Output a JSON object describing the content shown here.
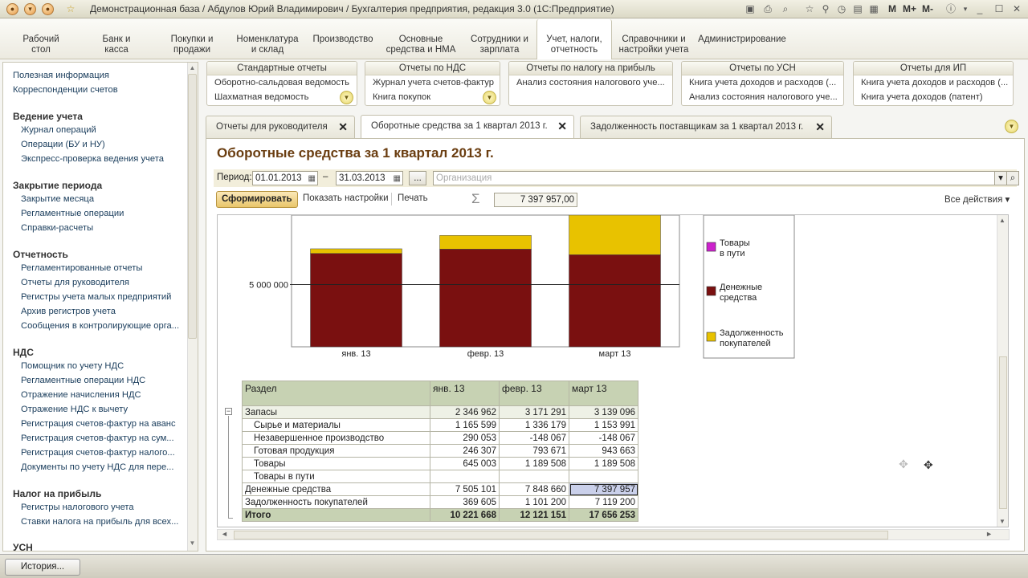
{
  "window": {
    "title": "Демонстрационная база / Абдулов Юрий Владимирович / Бухгалтерия предприятия, редакция 3.0  (1С:Предприятие)",
    "memory_buttons": [
      "M",
      "M+",
      "M-"
    ]
  },
  "sections": [
    "Рабочий стол",
    "Банк и касса",
    "Покупки и продажи",
    "Номенклатура и склад",
    "Производство",
    "Основные средства и НМА",
    "Сотрудники и зарплата",
    "Учет, налоги, отчетность",
    "Справочники и настройки учета",
    "Администрирование"
  ],
  "sidebar": {
    "top_links": [
      "Полезная информация",
      "Корреспонденции счетов"
    ],
    "groups": [
      {
        "title": "Ведение учета",
        "items": [
          "Журнал операций",
          "Операции (БУ и НУ)",
          "Экспресс-проверка ведения учета"
        ]
      },
      {
        "title": "Закрытие периода",
        "items": [
          "Закрытие месяца",
          "Регламентные операции",
          "Справки-расчеты"
        ]
      },
      {
        "title": "Отчетность",
        "items": [
          "Регламентированные отчеты",
          "Отчеты для руководителя",
          "Регистры учета малых предприятий",
          "Архив регистров учета",
          "Сообщения в контролирующие орга..."
        ]
      },
      {
        "title": "НДС",
        "items": [
          "Помощник по учету НДС",
          "Регламентные операции НДС",
          "Отражение начисления НДС",
          "Отражение НДС к вычету",
          "Регистрация счетов-фактур на аванс",
          "Регистрация счетов-фактур на сум...",
          "Регистрация счетов-фактур налого...",
          "Документы по учету НДС для пере..."
        ]
      },
      {
        "title": "Налог на прибыль",
        "items": [
          "Регистры налогового учета",
          "Ставки налога на прибыль для всех..."
        ]
      },
      {
        "title": "УСН",
        "items": []
      }
    ]
  },
  "report_panels": [
    {
      "title": "Стандартные отчеты",
      "items": [
        "Оборотно-сальдовая ведомость",
        "Шахматная ведомость"
      ]
    },
    {
      "title": "Отчеты по НДС",
      "items": [
        "Журнал учета счетов-фактур",
        "Книга покупок"
      ]
    },
    {
      "title": "Отчеты по налогу на прибыль",
      "items": [
        "Анализ состояния налогового уче..."
      ]
    },
    {
      "title": "Отчеты по УСН",
      "items": [
        "Книга учета доходов и расходов (...",
        "Анализ состояния налогового уче..."
      ]
    },
    {
      "title": "Отчеты для ИП",
      "items": [
        "Книга учета доходов и расходов (...",
        "Книга учета доходов (патент)"
      ]
    }
  ],
  "tabs": [
    {
      "label": "Отчеты для руководителя"
    },
    {
      "label": "Оборотные средства за 1 квартал 2013 г."
    },
    {
      "label": "Задолженность поставщикам за 1 квартал 2013 г."
    }
  ],
  "report": {
    "title": "Оборотные средства за 1 квартал 2013 г.",
    "period_label": "Период:",
    "date_from": "01.01.2013",
    "date_sep": "–",
    "date_to": "31.03.2013",
    "ellipsis": "...",
    "org_placeholder": "Организация",
    "form_button": "Сформировать",
    "show_settings": "Показать настройки",
    "print": "Печать",
    "sum_symbol": "Σ",
    "sum_value": "7 397 957,00",
    "all_actions": "Все действия ▾"
  },
  "chart_data": {
    "type": "bar",
    "stacked": true,
    "categories": [
      "янв. 13",
      "февр. 13",
      "март 13"
    ],
    "y_tick_label": "5 000 000",
    "y_tick_value": 5000000,
    "series": [
      {
        "name": "Товары в пути",
        "color": "#cc22cc",
        "values": [
          0,
          0,
          0
        ]
      },
      {
        "name": "Денежные средства",
        "color": "#7a1010",
        "values": [
          7505101,
          7848660,
          7397957
        ]
      },
      {
        "name": "Задолженность покупателей",
        "color": "#e8c200",
        "values": [
          369605,
          1101200,
          7119200
        ]
      }
    ],
    "legend": [
      "Товары в пути",
      "Денежные средства",
      "Задолженность покупателей"
    ],
    "legend_position": "right"
  },
  "table": {
    "headers": [
      "Раздел",
      "янв. 13",
      "февр. 13",
      "март 13"
    ],
    "rows": [
      {
        "label": "Запасы",
        "values": [
          "2 346 962",
          "3 171 291",
          "3 139 096"
        ],
        "kind": "grp"
      },
      {
        "label": "Сырье и материалы",
        "values": [
          "1 165 599",
          "1 336 179",
          "1 153 991"
        ],
        "kind": "sub"
      },
      {
        "label": "Незавершенное производство",
        "values": [
          "290 053",
          "-148 067",
          "-148 067"
        ],
        "kind": "sub"
      },
      {
        "label": "Готовая продукция",
        "values": [
          "246 307",
          "793 671",
          "943 663"
        ],
        "kind": "sub"
      },
      {
        "label": "Товары",
        "values": [
          "645 003",
          "1 189 508",
          "1 189 508"
        ],
        "kind": "sub"
      },
      {
        "label": "Товары в пути",
        "values": [
          "",
          "",
          ""
        ],
        "kind": "sub"
      },
      {
        "label": "Денежные средства",
        "values": [
          "7 505 101",
          "7 848 660",
          "7 397 957"
        ],
        "kind": "row"
      },
      {
        "label": "Задолженность покупателей",
        "values": [
          "369 605",
          "1 101 200",
          "7 119 200"
        ],
        "kind": "row"
      },
      {
        "label": "Итого",
        "values": [
          "10 221 668",
          "12 121 151",
          "17 656 253"
        ],
        "kind": "tot"
      }
    ]
  },
  "bottom": {
    "history": "История..."
  }
}
